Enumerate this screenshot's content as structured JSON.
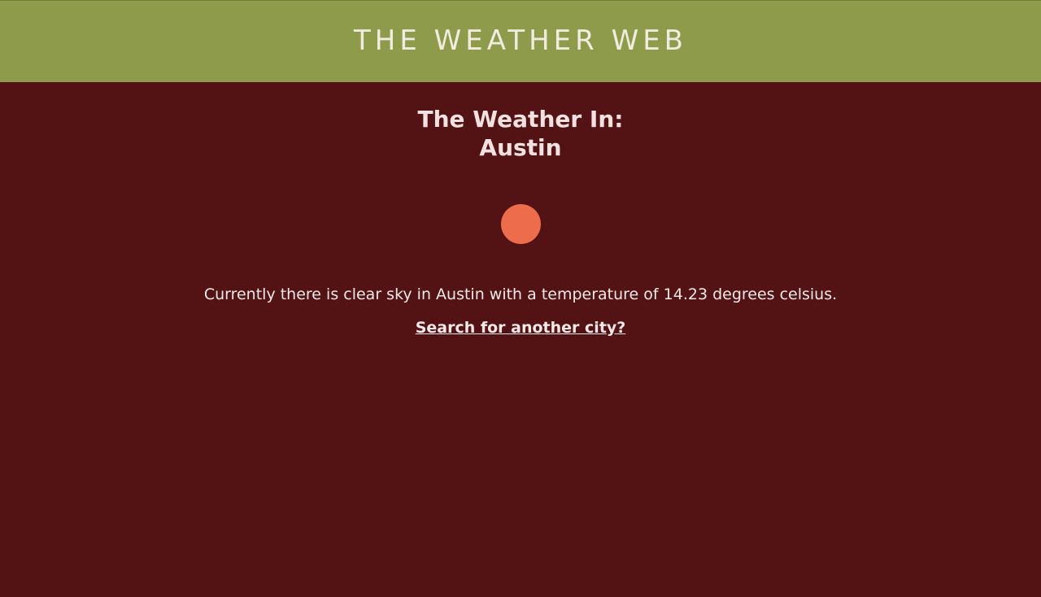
{
  "header": {
    "site_title": "THE WEATHER WEB"
  },
  "main": {
    "heading_line1": "The Weather In:",
    "heading_line2": "Austin",
    "weather_icon": "sun-icon",
    "description": "Currently there is clear sky in Austin with a temperature of 14.23 degrees celsius.",
    "search_link_label": "Search for another city?"
  },
  "colors": {
    "header_bg": "#8d9b4a",
    "page_bg": "#531214",
    "sun": "#ec6c4c",
    "text": "#f3e6e6"
  }
}
